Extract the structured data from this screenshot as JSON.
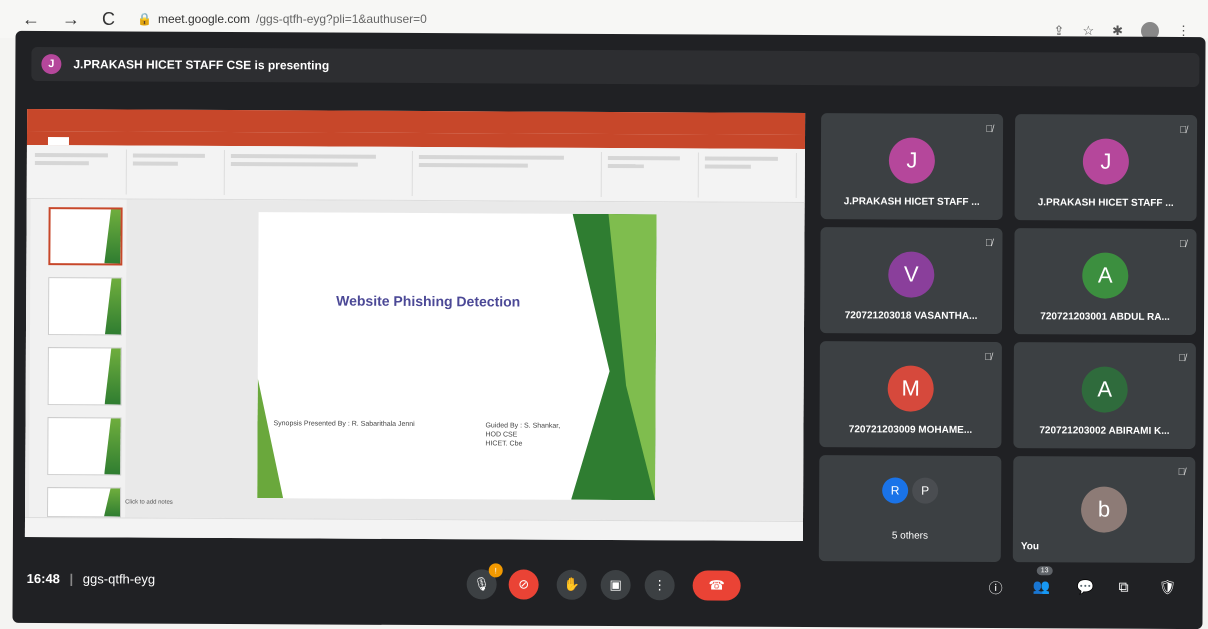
{
  "browser": {
    "back_glyph": "←",
    "forward_glyph": "→",
    "reload_glyph": "C",
    "url_domain": "meet.google.com",
    "url_rest": "/ggs-qtfh-eyg?pli=1&authuser=0"
  },
  "presenting": {
    "avatar_letter": "J",
    "text": "J.PRAKASH HICET STAFF CSE is presenting"
  },
  "slide": {
    "title": "Website Phishing Detection",
    "presenter": "Synopsis Presented By : R. Sabarithala Jenni",
    "guide": "Guided By : S. Shankar,\nHOD CSE\nHICET. Cbe",
    "notes": "Click to add notes"
  },
  "tiles": [
    {
      "letter": "J",
      "name": "J.PRAKASH HICET STAFF ...",
      "color": "#b5479b"
    },
    {
      "letter": "J",
      "name": "J.PRAKASH HICET STAFF ...",
      "color": "#b5479b"
    },
    {
      "letter": "V",
      "name": "720721203018 VASANTHA...",
      "color": "#8a3f9b"
    },
    {
      "letter": "A",
      "name": "720721203001 ABDUL RA...",
      "color": "#3c8f3f"
    },
    {
      "letter": "M",
      "name": "720721203009 MOHAME...",
      "color": "#d6493c"
    },
    {
      "letter": "A",
      "name": "720721203002 ABIRAMI K...",
      "color": "#2f6b3c"
    }
  ],
  "others": {
    "a": "R",
    "b": "P",
    "label": "5 others"
  },
  "you": {
    "letter": "b",
    "label": "You"
  },
  "controls": {
    "time": "16:48",
    "separator": "|",
    "meeting_code": "ggs-qtfh-eyg",
    "people_count": "13"
  }
}
